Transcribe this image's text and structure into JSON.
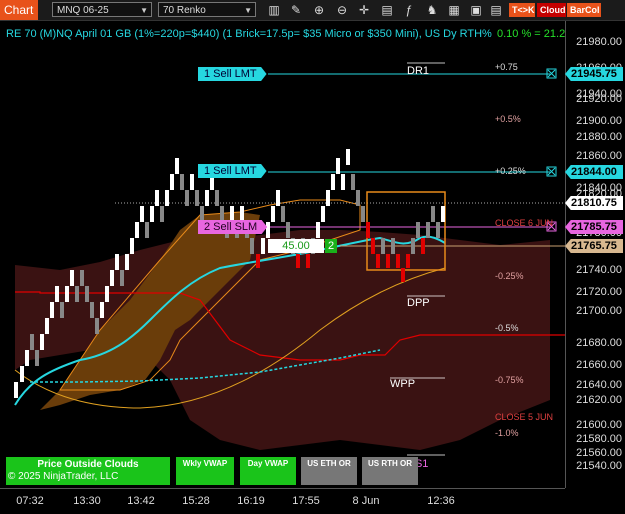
{
  "toolbar": {
    "tab_label": "Chart",
    "instrument": "MNQ 06-25",
    "bar_type": "70 Renko",
    "icons": [
      "bars-icon",
      "tools-icon",
      "zoom-in-icon",
      "zoom-out-icon",
      "crosshair-icon",
      "chart-properties-icon",
      "indicators-icon",
      "strategies-icon",
      "templates-icon",
      "data-box-icon"
    ],
    "toggle_label": "T<>K",
    "cloud_label": "Cloud",
    "barcol_label": "BarCol"
  },
  "title": "RE 70 (M)NQ April 01 GB (1%=220p=$440) (1 Brick=17.5p= $35 Micro or $350 Mini), US Dy RTH%",
  "top_right_value": "0.10 % = 21.25",
  "colors": {
    "accent": "#e8521a",
    "cyan": "#26d7e0",
    "orange": "#e88a1a",
    "red": "#e00000",
    "pink_label": "#e866e0"
  },
  "price_axis": {
    "ticks": [
      "21980.00",
      "21960.00",
      "21940.00",
      "21920.00",
      "21900.00",
      "21880.00",
      "21860.00",
      "21840.00",
      "21820.00",
      "21800.00",
      "21780.00",
      "21760.00",
      "21740.00",
      "21720.00",
      "21700.00",
      "21680.00",
      "21660.00",
      "21640.00",
      "21620.00",
      "21600.00",
      "21580.00",
      "21560.00",
      "21540.00"
    ],
    "tags": {
      "sell_lmt_1": "21945.75",
      "sell_lmt_2": "21844.00",
      "last": "21810.75",
      "sell_slm": "21785.75",
      "entry": "21765.75"
    }
  },
  "time_axis": [
    "07:32",
    "13:30",
    "13:42",
    "15:28",
    "16:19",
    "17:55",
    "8 Jun",
    "12:36"
  ],
  "levels": {
    "dr1": "DR1",
    "dpp": "DPP",
    "wpp": "WPP",
    "ds1": "DS1"
  },
  "pct_labels": {
    "p075": "+0.75",
    "p05": "+0.5%",
    "p025": "+0.25%",
    "close6": "CLOSE 6 JUN",
    "m025": "-0.25%",
    "m05": "-0.5%",
    "m075": "-0.75%",
    "close5": "CLOSE 5 JUN",
    "m1": "-1.0%"
  },
  "orders": {
    "sell_lmt_1": "1 Sell LMT",
    "sell_lmt_2": "1 Sell LMT",
    "sell_slm": "2 Sell SLM",
    "entry_pnl": "45.00",
    "entry_qty": "2"
  },
  "bottom_buttons": {
    "price_outside": "Price Outside Clouds",
    "copyright": "© 2025 NinjaTrader, LLC",
    "wkly_vwap": "Wkly VWAP",
    "day_vwap": "Day VWAP",
    "us_eth_or": "US ETH OR",
    "us_rth_or": "US RTH OR"
  }
}
